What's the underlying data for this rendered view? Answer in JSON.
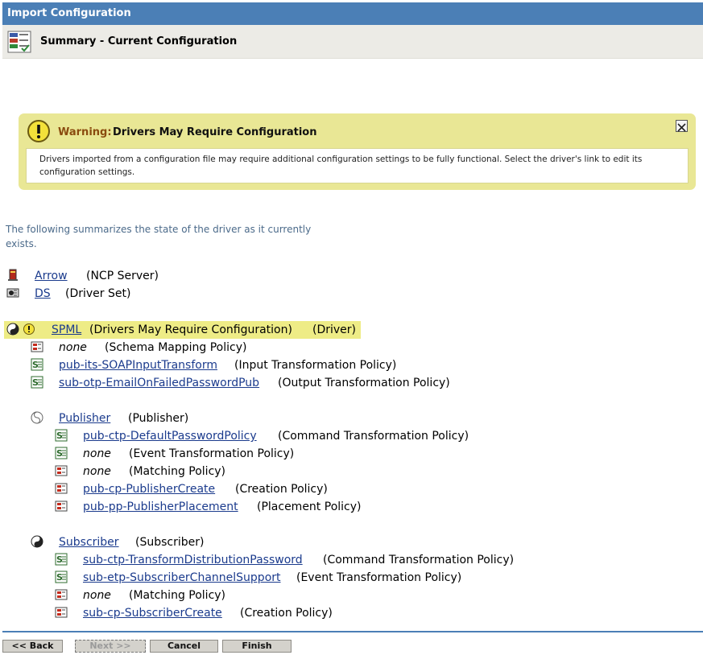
{
  "window": {
    "title": "Import Configuration"
  },
  "header": {
    "title": "Summary - Current Configuration",
    "icon": "summary-icon"
  },
  "warning": {
    "label": "Warning:",
    "title": "Drivers May Require Configuration",
    "body": "Drivers imported from a configuration file may require additional configuration settings to be fully functional. Select the driver's link to edit its configuration settings.",
    "close_icon": "close-icon"
  },
  "intro": "The following summarizes the state of the driver as it currently exists.",
  "tree": {
    "server": {
      "name": "Arrow",
      "type": "(NCP Server)",
      "icon": "server-icon"
    },
    "driverset": {
      "name": "DS",
      "type": "(Driver Set)",
      "icon": "driverset-icon"
    },
    "driver": {
      "name": "SPML",
      "status": "(Drivers May Require Configuration)",
      "type": "(Driver)",
      "icon": "driver-icon",
      "warn_icon": "warning-icon"
    },
    "driver_policies": [
      {
        "name": "none",
        "type": "(Schema Mapping Policy)",
        "link": false,
        "icon": "schema-policy-icon"
      },
      {
        "name": "pub-its-SOAPInputTransform",
        "type": "(Input Transformation Policy)",
        "link": true,
        "icon": "stylesheet-icon"
      },
      {
        "name": "sub-otp-EmailOnFailedPasswordPub",
        "type": "(Output Transformation Policy)",
        "link": true,
        "icon": "stylesheet-icon"
      }
    ],
    "publisher": {
      "name": "Publisher",
      "type": "(Publisher)",
      "icon": "publisher-icon",
      "policies": [
        {
          "name": "pub-ctp-DefaultPasswordPolicy",
          "type": "(Command Transformation Policy)",
          "link": true,
          "icon": "stylesheet-icon"
        },
        {
          "name": "none",
          "type": "(Event Transformation Policy)",
          "link": false,
          "icon": "stylesheet-icon"
        },
        {
          "name": "none",
          "type": "(Matching Policy)",
          "link": false,
          "icon": "rule-policy-icon"
        },
        {
          "name": "pub-cp-PublisherCreate",
          "type": "(Creation Policy)",
          "link": true,
          "icon": "rule-policy-icon"
        },
        {
          "name": "pub-pp-PublisherPlacement",
          "type": "(Placement Policy)",
          "link": true,
          "icon": "rule-policy-icon"
        }
      ]
    },
    "subscriber": {
      "name": "Subscriber",
      "type": "(Subscriber)",
      "icon": "subscriber-icon",
      "policies": [
        {
          "name": "sub-ctp-TransformDistributionPassword",
          "type": "(Command Transformation Policy)",
          "link": true,
          "icon": "stylesheet-icon"
        },
        {
          "name": "sub-etp-SubscriberChannelSupport",
          "type": "(Event Transformation Policy)",
          "link": true,
          "icon": "stylesheet-icon"
        },
        {
          "name": "none",
          "type": "(Matching Policy)",
          "link": false,
          "icon": "rule-policy-icon"
        },
        {
          "name": "sub-cp-SubscriberCreate",
          "type": "(Creation Policy)",
          "link": true,
          "icon": "rule-policy-icon"
        }
      ]
    }
  },
  "buttons": {
    "back": "<< Back",
    "next": "Next >>",
    "cancel": "Cancel",
    "finish": "Finish"
  },
  "colors": {
    "titlebar": "#4b7fb6",
    "warning_bg": "#e9e795",
    "link": "#1b3b8d",
    "highlight": "#eeec86"
  }
}
